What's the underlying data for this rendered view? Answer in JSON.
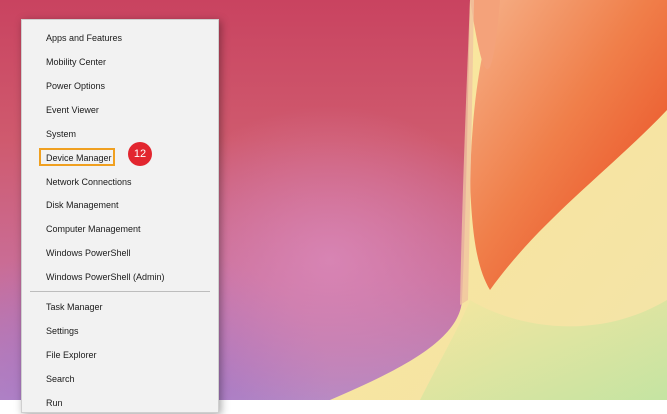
{
  "menu": {
    "items": [
      {
        "label": "Apps and Features"
      },
      {
        "label": "Mobility Center"
      },
      {
        "label": "Power Options"
      },
      {
        "label": "Event Viewer"
      },
      {
        "label": "System"
      },
      {
        "label": "Device Manager"
      },
      {
        "label": "Network Connections"
      },
      {
        "label": "Disk Management"
      },
      {
        "label": "Computer Management"
      },
      {
        "label": "Windows PowerShell"
      },
      {
        "label": "Windows PowerShell (Admin)"
      },
      {
        "label": "Task Manager"
      },
      {
        "label": "Settings"
      },
      {
        "label": "File Explorer"
      },
      {
        "label": "Search"
      },
      {
        "label": "Run"
      }
    ]
  },
  "annotation": {
    "step_number": "12",
    "highlight_color": "#f0a020",
    "badge_color": "#e2262f"
  },
  "wallpaper": {
    "colors": [
      "#c94360",
      "#cf5a6e",
      "#c96f9a",
      "#b58ac4",
      "#f7e08a",
      "#e8421c"
    ]
  }
}
